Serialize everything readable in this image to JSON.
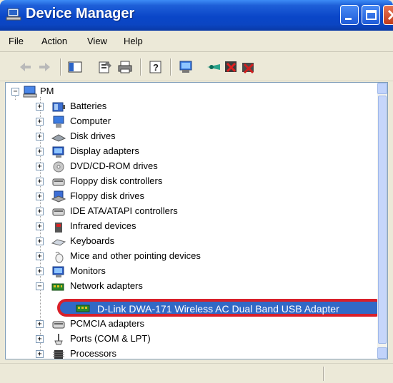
{
  "window": {
    "title": "Device Manager"
  },
  "menu": {
    "items": [
      "File",
      "Action",
      "View",
      "Help"
    ]
  },
  "toolbar": {
    "icons": [
      "back-arrow-icon",
      "forward-arrow-icon",
      "show-hide-console-icon",
      "properties-icon",
      "print-icon",
      "help-icon",
      "scan-hardware-icon",
      "update-driver-icon",
      "disable-icon",
      "uninstall-icon"
    ]
  },
  "tree": {
    "root": "PM",
    "categories": [
      {
        "label": "Batteries",
        "icon": "battery-icon"
      },
      {
        "label": "Computer",
        "icon": "computer-icon"
      },
      {
        "label": "Disk drives",
        "icon": "disk-drive-icon"
      },
      {
        "label": "Display adapters",
        "icon": "display-adapter-icon"
      },
      {
        "label": "DVD/CD-ROM drives",
        "icon": "dvd-drive-icon"
      },
      {
        "label": "Floppy disk controllers",
        "icon": "floppy-controller-icon"
      },
      {
        "label": "Floppy disk drives",
        "icon": "floppy-drive-icon"
      },
      {
        "label": "IDE ATA/ATAPI controllers",
        "icon": "ide-controller-icon"
      },
      {
        "label": "Infrared devices",
        "icon": "infrared-icon"
      },
      {
        "label": "Keyboards",
        "icon": "keyboard-icon"
      },
      {
        "label": "Mice and other pointing devices",
        "icon": "mouse-icon"
      },
      {
        "label": "Monitors",
        "icon": "monitor-icon"
      },
      {
        "label": "Network adapters",
        "icon": "network-adapter-icon",
        "expanded": true
      }
    ],
    "selected_device": "D-Link DWA-171 Wireless AC Dual Band USB Adapter",
    "after": [
      {
        "label": "PCMCIA adapters",
        "icon": "pcmcia-icon"
      },
      {
        "label": "Ports (COM & LPT)",
        "icon": "port-icon"
      },
      {
        "label": "Processors",
        "icon": "processor-icon"
      }
    ]
  },
  "colors": {
    "selection": "#3169c6",
    "highlight_ring": "#d8202a",
    "titlebar": "#0a46c8"
  }
}
